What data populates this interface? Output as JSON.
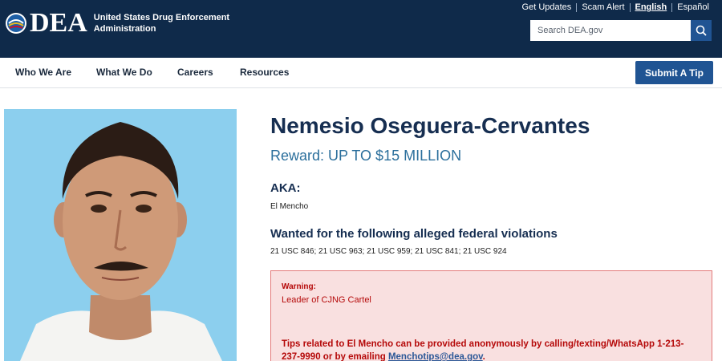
{
  "header": {
    "logo_text": "DEA",
    "agency_line1": "United States Drug Enforcement",
    "agency_line2": "Administration",
    "utility_links": [
      "Get Updates",
      "Scam Alert",
      "English",
      "Español"
    ],
    "active_language": "English",
    "search_placeholder": "Search DEA.gov",
    "search_icon": "magnifier-icon",
    "bg_color": "#0f2a4a"
  },
  "nav": {
    "items": [
      "Who We Are",
      "What We Do",
      "Careers",
      "Resources"
    ],
    "tip_button": "Submit A Tip",
    "accent_color": "#205493"
  },
  "profile": {
    "name": "Nemesio Oseguera-Cervantes",
    "reward": "Reward: UP TO $15 MILLION",
    "aka_heading": "AKA:",
    "aka_value": "El Mencho",
    "violations_heading": "Wanted for the following alleged federal violations",
    "violations": "21 USC 846; 21 USC 963; 21 USC 959; 21 USC 841; 21 USC 924"
  },
  "alert": {
    "label": "Warning:",
    "text": "Leader of CJNG Cartel",
    "tips_prefix": "Tips related to El Mencho can be provided anonymously by calling/texting/WhatsApp 1-213-237-9990 or by emailing ",
    "tips_email": "Menchotips@dea.gov",
    "tips_suffix": ".",
    "color": "#b50909"
  }
}
